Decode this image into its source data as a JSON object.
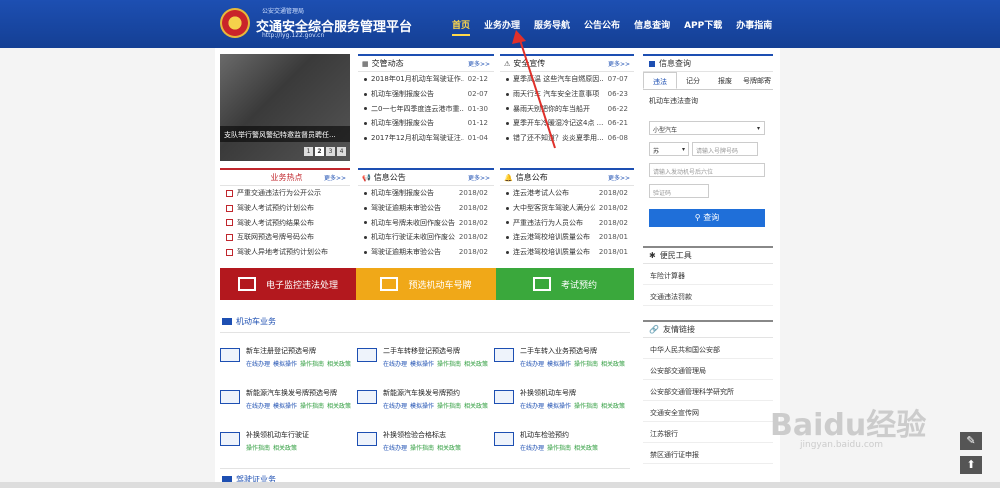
{
  "header": {
    "subtitle": "公安交通管理局",
    "title": "交通安全综合服务管理平台",
    "url": "http://lyg.122.gov.cn",
    "nav": [
      "首页",
      "业务办理",
      "服务导航",
      "公告公布",
      "信息查询",
      "APP下载",
      "办事指南"
    ]
  },
  "slide": {
    "caption": "支队举行警风警纪特邀监督员聘任...",
    "pages": [
      "1",
      "2",
      "3",
      "4"
    ]
  },
  "traffic": {
    "title": "交管动态",
    "more": "更多>>",
    "items": [
      {
        "t": "2018年01月机动车驾驶证作...",
        "d": "02-12"
      },
      {
        "t": "机动车强制报废公告",
        "d": "02-07"
      },
      {
        "t": "二0一七年四季度连云港市重...",
        "d": "01-30"
      },
      {
        "t": "机动车强制报废公告",
        "d": "01-12"
      },
      {
        "t": "2017年12月机动车驾驶证注...",
        "d": "01-04"
      }
    ]
  },
  "safety": {
    "title": "安全宣传",
    "more": "更多>>",
    "items": [
      {
        "t": "夏季高温 这些汽车自燃原因...",
        "d": "07-07"
      },
      {
        "t": "雨天行车 汽车安全注意事项",
        "d": "06-23"
      },
      {
        "t": "暴雨天别把你的车当船开",
        "d": "06-22"
      },
      {
        "t": "夏季开车冷暖湿冷记这4点 ...",
        "d": "06-21"
      },
      {
        "t": "错了还不知道？炎炎夏季用...",
        "d": "06-08"
      }
    ]
  },
  "hot": {
    "title": "业务热点",
    "more": "更多>>",
    "items": [
      "严重交通违法行为公开公示",
      "驾驶人考试预约计划公布",
      "驾驶人考试预约结果公布",
      "互联网预选号牌号码公布",
      "驾驶人异地考试预约计划公布"
    ]
  },
  "info": {
    "title": "信息公告",
    "more": "更多>>",
    "items": [
      {
        "t": "机动车强制报废公告",
        "d": "2018/02"
      },
      {
        "t": "驾驶证逾期未审验公告",
        "d": "2018/02"
      },
      {
        "t": "机动车号牌未收回作废公告",
        "d": "2018/02"
      },
      {
        "t": "机动车行驶证未收回作废公告",
        "d": "2018/02"
      },
      {
        "t": "驾驶证逾期未审验公告",
        "d": "2018/02"
      }
    ]
  },
  "notice": {
    "title": "信息公布",
    "more": "更多>>",
    "items": [
      {
        "t": "连云港考试人公布",
        "d": "2018/02"
      },
      {
        "t": "大中型客货车驾驶人满分公布",
        "d": "2018/02"
      },
      {
        "t": "严重违法行为人员公布",
        "d": "2018/02"
      },
      {
        "t": "连云港驾校培训质量公布",
        "d": "2018/01"
      },
      {
        "t": "连云港驾校培训质量公布",
        "d": "2018/01"
      }
    ]
  },
  "banners": [
    "电子监控违法处理",
    "预选机动车号牌",
    "考试预约"
  ],
  "banner_colors": [
    "#b3181e",
    "#f0a818",
    "#3aa83c"
  ],
  "vehicle": {
    "title": "机动车业务",
    "items": [
      {
        "n": "新车注册登记预选号牌",
        "l": [
          "在线办理",
          "模拟操作",
          "操作指南",
          "相关政策"
        ]
      },
      {
        "n": "二手车转移登记预选号牌",
        "l": [
          "在线办理",
          "模拟操作",
          "操作指南",
          "相关政策"
        ]
      },
      {
        "n": "二手车转入业务预选号牌",
        "l": [
          "在线办理",
          "模拟操作",
          "操作指南",
          "相关政策"
        ]
      },
      {
        "n": "新能源汽车换发号牌预选号牌",
        "l": [
          "在线办理",
          "模拟操作",
          "操作指南",
          "相关政策"
        ]
      },
      {
        "n": "新能源汽车换发号牌预约",
        "l": [
          "在线办理",
          "模拟操作",
          "操作指南",
          "相关政策"
        ]
      },
      {
        "n": "补换领机动车号牌",
        "l": [
          "在线办理",
          "模拟操作",
          "操作指南",
          "相关政策"
        ]
      },
      {
        "n": "补换领机动车行驶证",
        "l": [
          "操作指南",
          "相关政策"
        ]
      },
      {
        "n": "补换领检验合格标志",
        "l": [
          "在线办理",
          "操作指南",
          "相关政策"
        ]
      },
      {
        "n": "机动车检验预约",
        "l": [
          "在线办理",
          "操作指南",
          "相关政策"
        ]
      }
    ]
  },
  "next_section": "驾驶证业务",
  "query": {
    "title": "信息查询",
    "tabs": [
      "违法",
      "记分",
      "报废",
      "号牌邮寄"
    ],
    "label": "机动车违法查询",
    "vehicle_type": "小型汽车",
    "province": "苏",
    "plate_placeholder": "请输入号牌号码",
    "engine_placeholder": "请输入发动机号后六位",
    "captcha_placeholder": "验证码",
    "button": "查询"
  },
  "tools": {
    "title": "便民工具",
    "items": [
      "车险计算器",
      "交通违法罚款"
    ]
  },
  "friends": {
    "title": "友情链接",
    "items": [
      "中华人民共和国公安部",
      "公安部交通管理局",
      "公安部交通管理科学研究所",
      "交通安全宣传网",
      "江苏银行",
      "禁区通行证申报"
    ]
  },
  "watermark": {
    "main": "Baidu经验",
    "sub": "jingyan.baidu.com"
  },
  "side_buttons": [
    "✎",
    "⬆"
  ]
}
